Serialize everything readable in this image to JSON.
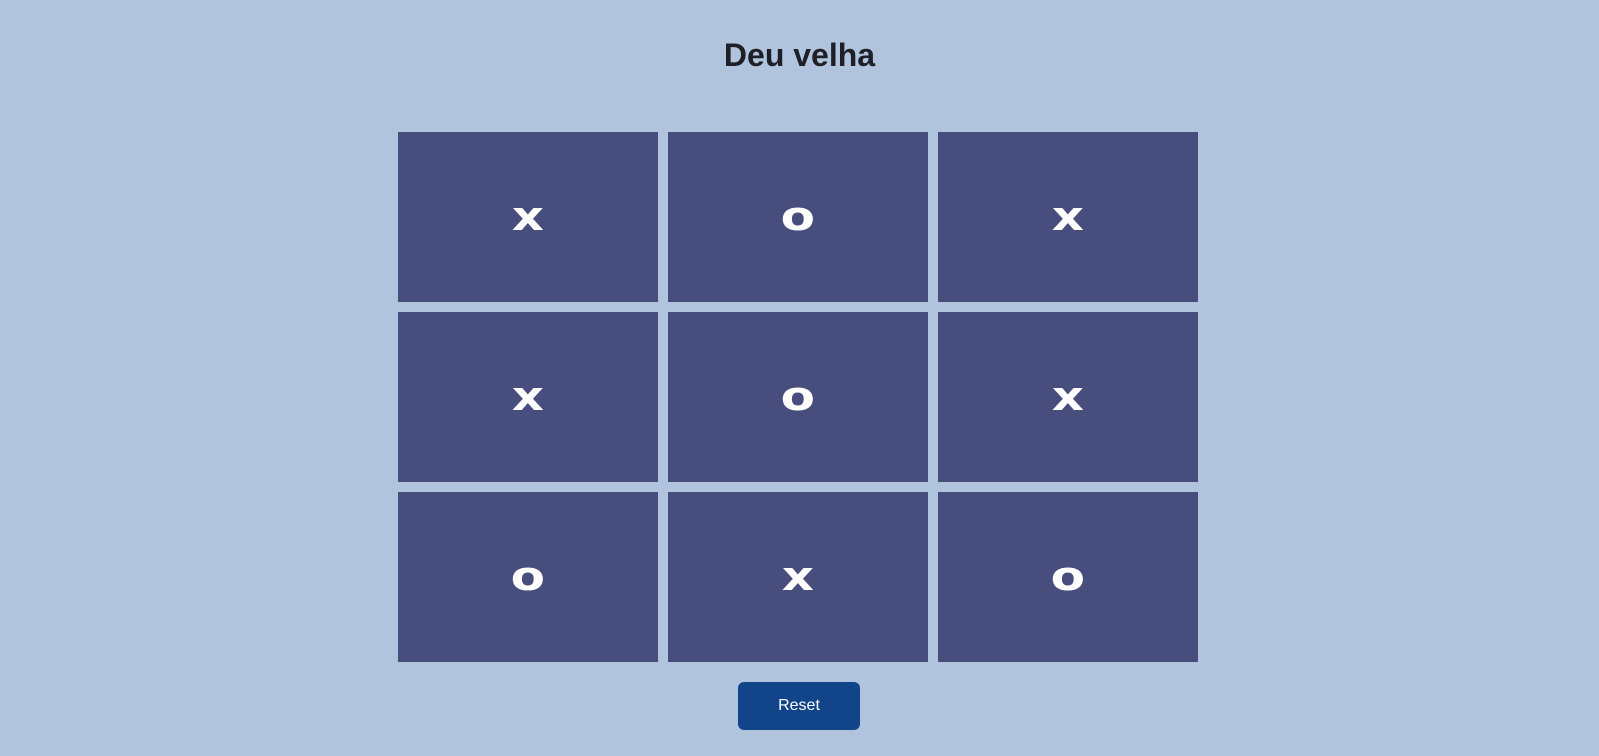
{
  "title": "Deu velha",
  "board": {
    "cells": [
      "x",
      "o",
      "x",
      "x",
      "o",
      "x",
      "o",
      "x",
      "o"
    ]
  },
  "reset_label": "Reset",
  "colors": {
    "background": "#b0c4de",
    "cell": "#474d7c",
    "mark": "#ffffff",
    "button": "#12448a"
  }
}
